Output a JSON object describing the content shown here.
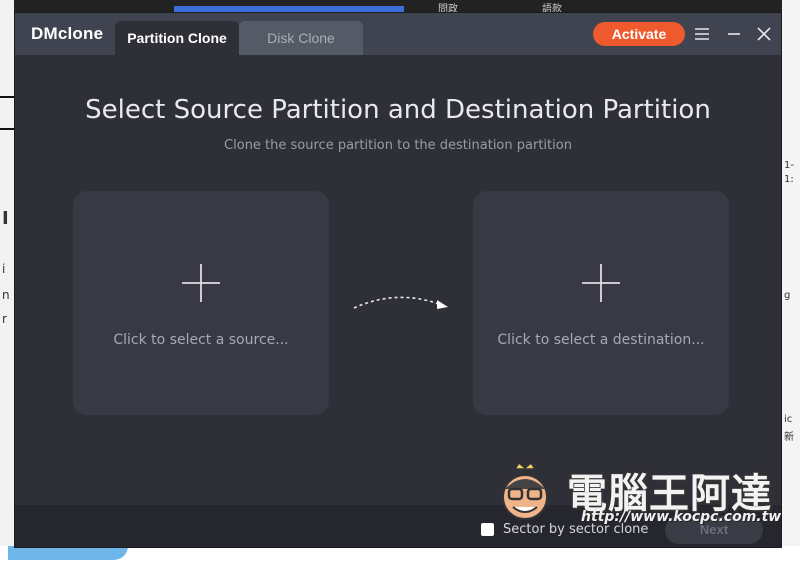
{
  "app": {
    "logo": "DMclone",
    "tabs": [
      {
        "label": "Partition Clone",
        "active": true
      },
      {
        "label": "Disk Clone",
        "active": false
      }
    ],
    "activate_label": "Activate"
  },
  "main": {
    "title": "Select Source Partition and Destination Partition",
    "subtitle": "Clone the source partition to the destination partition",
    "source_label": "Click to select a source...",
    "destination_label": "Click to select a destination..."
  },
  "footer": {
    "sector_label": "Sector by sector clone",
    "sector_checked": false,
    "next_label": "Next"
  },
  "watermark": {
    "text": "電腦王阿達",
    "url": "http://www.kocpc.com.tw"
  },
  "background": {
    "left_fragments": [
      "I",
      "i",
      "n",
      "r"
    ],
    "right_fragments": [
      "1-",
      "1:",
      "ic",
      "g",
      "新"
    ],
    "top_fragments": [
      "問政",
      "語款"
    ]
  },
  "colors": {
    "accent": "#ee5a2d",
    "window_bg": "#2f2f38",
    "titlebar_bg": "#3f4450",
    "card_bg": "#383944",
    "footer_bg": "#26272e"
  },
  "icons": {
    "menu": "hamburger-icon",
    "minimize": "minimize-icon",
    "close": "close-icon",
    "add": "plus-icon",
    "arrow": "dashed-arrow-icon"
  }
}
